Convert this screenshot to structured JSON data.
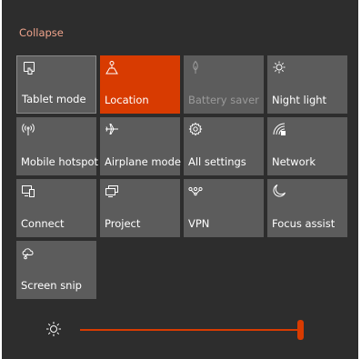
{
  "collapse_label": "Collapse",
  "colors": {
    "panel": "#2d2d2d",
    "tile": "#5c5c5c",
    "accent": "#d83b01",
    "collapse_text": "#f0a48c"
  },
  "tiles": [
    {
      "label": "Tablet mode",
      "icon": "tablet-mode-icon",
      "state": "off"
    },
    {
      "label": "Location",
      "icon": "location-icon",
      "state": "on"
    },
    {
      "label": "Battery saver",
      "icon": "battery-saver-icon",
      "state": "disabled"
    },
    {
      "label": "Night light",
      "icon": "night-light-icon",
      "state": "off"
    },
    {
      "label": "Mobile hotspot",
      "icon": "mobile-hotspot-icon",
      "state": "off"
    },
    {
      "label": "Airplane mode",
      "icon": "airplane-icon",
      "state": "off"
    },
    {
      "label": "All settings",
      "icon": "gear-icon",
      "state": "off"
    },
    {
      "label": "Network",
      "icon": "network-icon",
      "state": "off"
    },
    {
      "label": "Connect",
      "icon": "connect-icon",
      "state": "off"
    },
    {
      "label": "Project",
      "icon": "project-icon",
      "state": "off"
    },
    {
      "label": "VPN",
      "icon": "vpn-icon",
      "state": "off"
    },
    {
      "label": "Focus assist",
      "icon": "moon-icon",
      "state": "off"
    },
    {
      "label": "Screen snip",
      "icon": "screen-snip-icon",
      "state": "off"
    }
  ],
  "brightness": {
    "icon": "brightness-icon",
    "level_percent": 100
  }
}
